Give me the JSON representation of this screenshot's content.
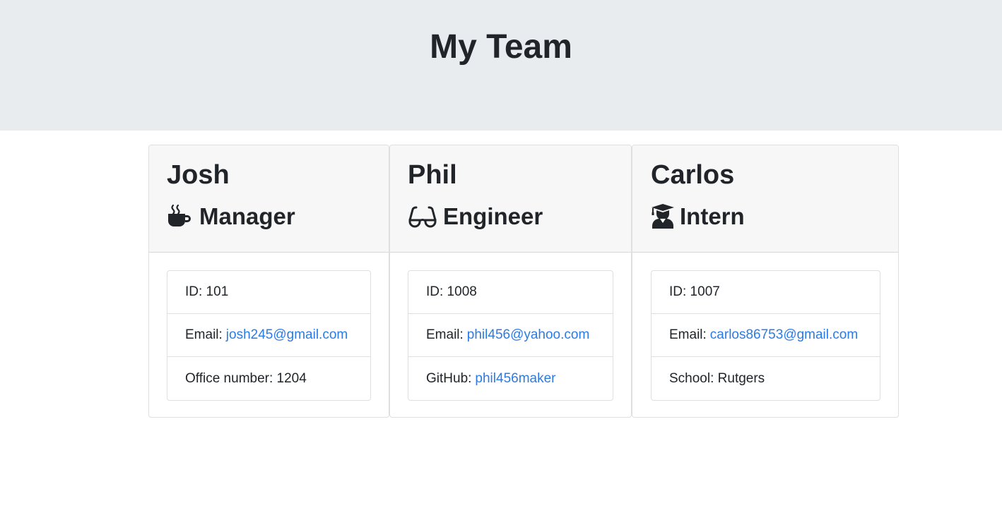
{
  "header": {
    "title": "My Team"
  },
  "team": [
    {
      "name": "Josh",
      "role": "Manager",
      "icon": "coffee-icon",
      "id_line": "ID: 101",
      "email_label": "Email:",
      "email": "josh245@gmail.com",
      "extra_label": "Office number: 1204",
      "extra_link": ""
    },
    {
      "name": "Phil",
      "role": "Engineer",
      "icon": "glasses-icon",
      "id_line": "ID: 1008",
      "email_label": "Email:",
      "email": "phil456@yahoo.com",
      "extra_label": "GitHub:",
      "extra_link": "phil456maker"
    },
    {
      "name": "Carlos",
      "role": "Intern",
      "icon": "user-graduate-icon",
      "id_line": "ID: 1007",
      "email_label": "Email:",
      "email": "carlos86753@gmail.com",
      "extra_label": "School: Rutgers",
      "extra_link": ""
    }
  ],
  "colors": {
    "link": "#2c7be5",
    "jumbotron": "#e9ecef",
    "card_header": "#f7f7f7"
  }
}
